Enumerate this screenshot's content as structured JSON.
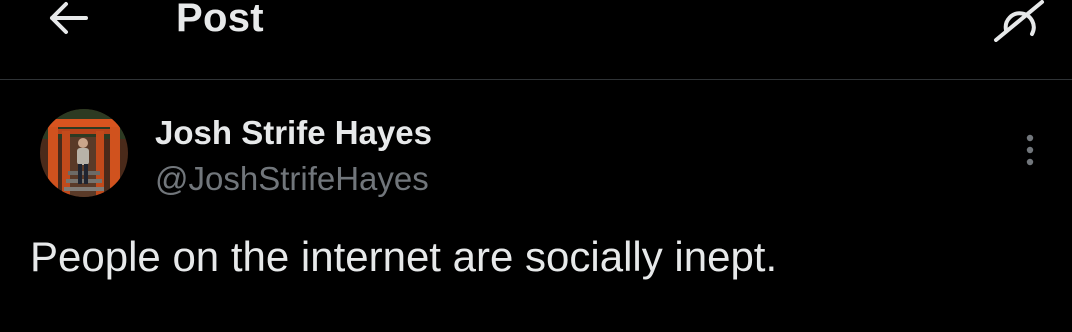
{
  "header": {
    "title": "Post",
    "back_icon": "arrow-left-icon",
    "grok_icon": "grok-icon"
  },
  "post": {
    "author": {
      "name": "Josh Strife Hayes",
      "handle": "@JoshStrifeHayes",
      "avatar_icon": "avatar-photo"
    },
    "text": "People on the internet are socially inept.",
    "more_icon": "more-vertical-icon"
  },
  "colors": {
    "background": "#000000",
    "primary_text": "#e7e9ea",
    "secondary_text": "#71767b",
    "divider": "#2f3336"
  }
}
